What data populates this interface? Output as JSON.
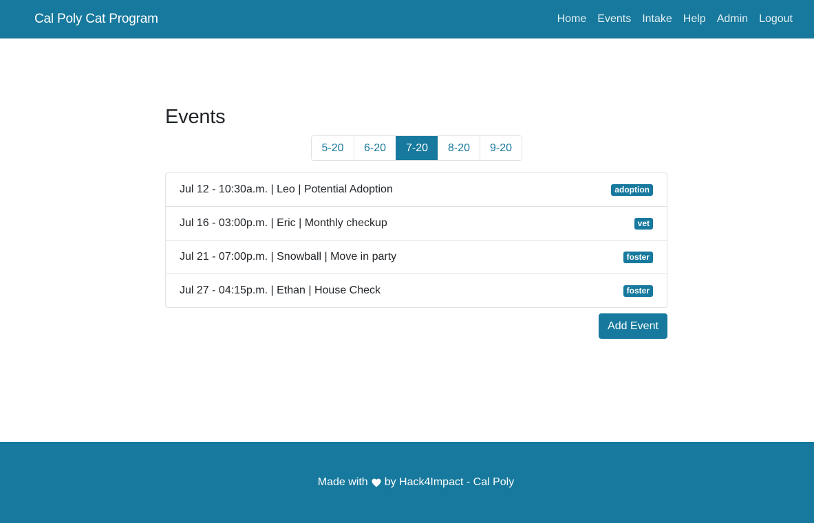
{
  "navbar": {
    "brand": "Cal Poly Cat Program",
    "links": [
      "Home",
      "Events",
      "Intake",
      "Help",
      "Admin",
      "Logout"
    ]
  },
  "main": {
    "title": "Events",
    "months": [
      "5-20",
      "6-20",
      "7-20",
      "8-20",
      "9-20"
    ],
    "active_month": "7-20",
    "events": [
      {
        "text": "Jul 12 - 10:30a.m. | Leo | Potential Adoption",
        "tag": "adoption"
      },
      {
        "text": "Jul 16 - 03:00p.m. | Eric | Monthly checkup",
        "tag": "vet"
      },
      {
        "text": "Jul 21 - 07:00p.m. | Snowball | Move in party",
        "tag": "foster"
      },
      {
        "text": "Jul 27 - 04:15p.m. | Ethan | House Check",
        "tag": "foster"
      }
    ],
    "add_button": "Add Event"
  },
  "footer": {
    "before_heart": "Made with",
    "after_heart": "by Hack4Impact - Cal Poly",
    "heart_icon": "heart-icon"
  },
  "colors": {
    "primary": "#17799d",
    "text": "#212529",
    "border": "#dee2e6"
  }
}
